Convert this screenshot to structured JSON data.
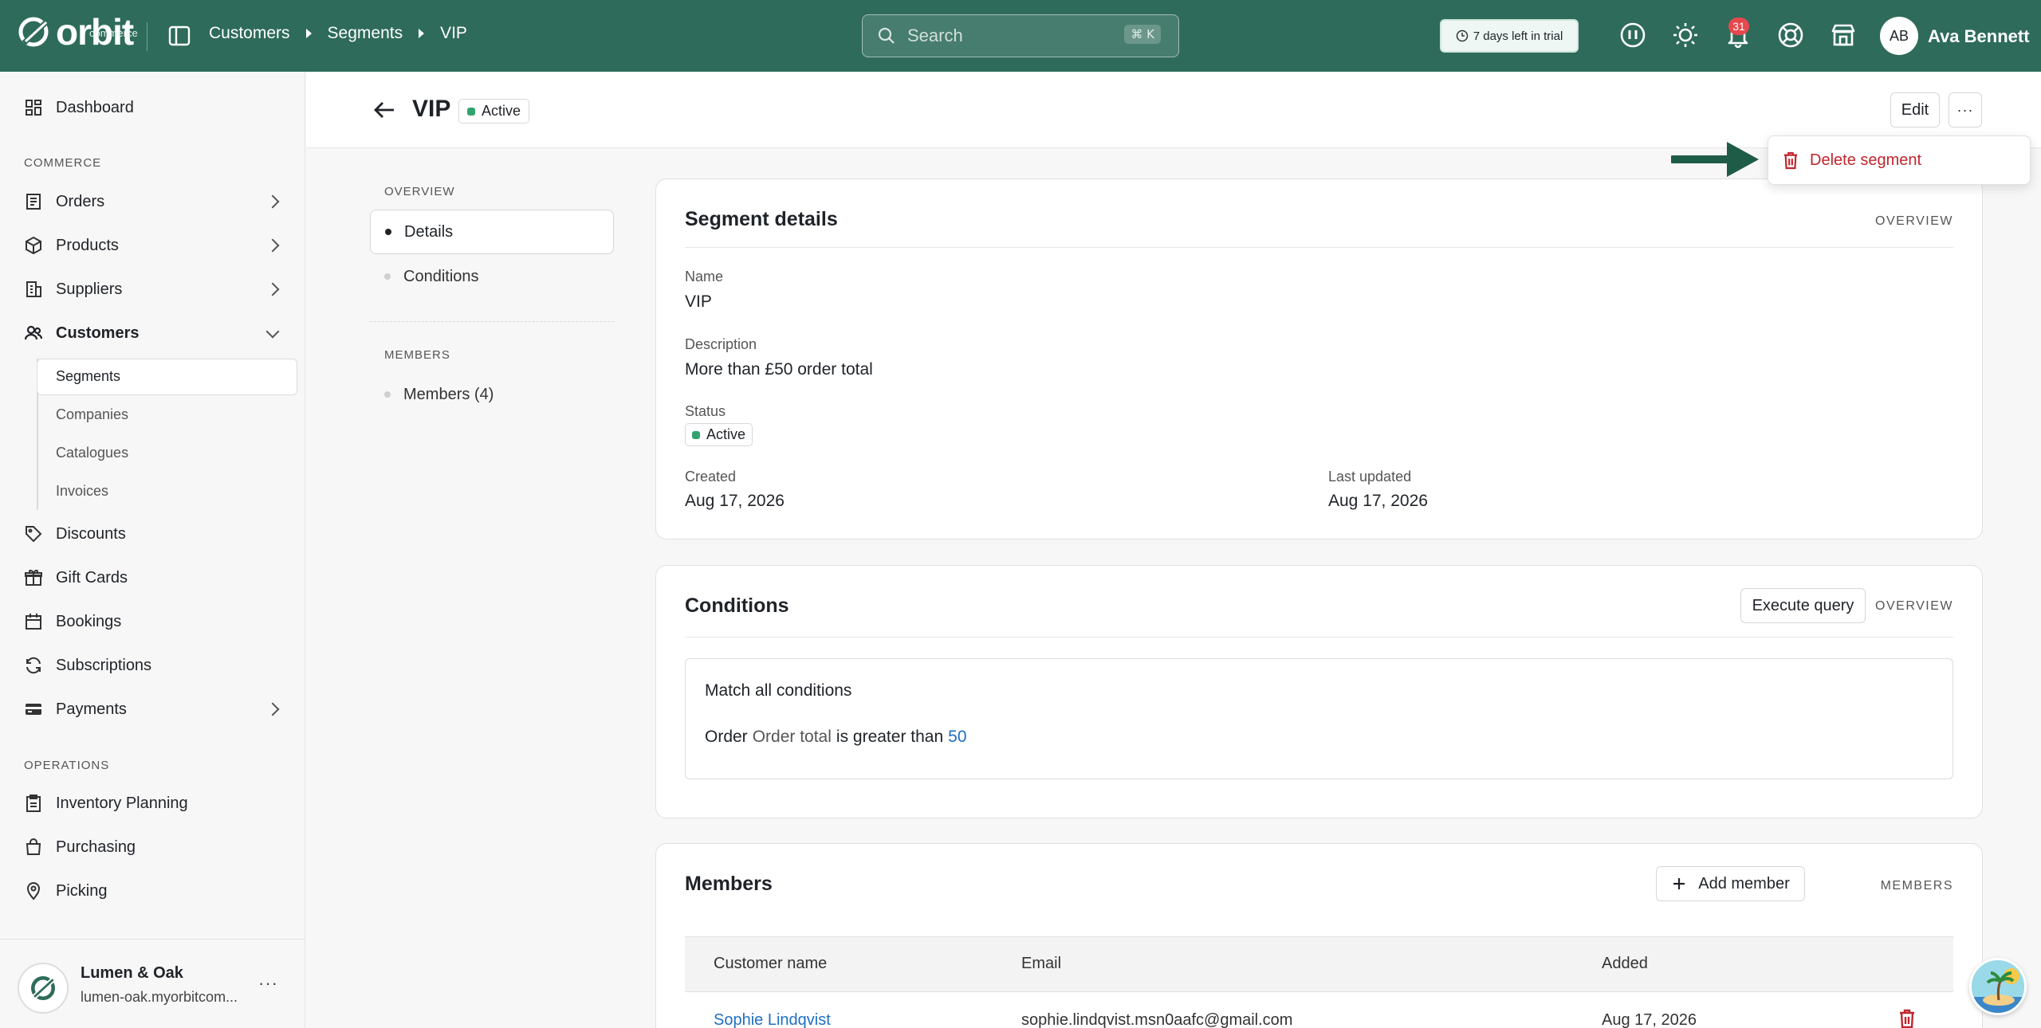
{
  "topbar": {
    "logo_text": "orbit",
    "logo_sub": "commerce",
    "breadcrumbs": [
      "Customers",
      "Segments",
      "VIP"
    ],
    "search_placeholder": "Search",
    "search_shortcut": "⌘ K",
    "trial_text": "7 days left in trial",
    "notification_count": "31",
    "user_initials": "AB",
    "user_name": "Ava Bennett"
  },
  "sidebar": {
    "dashboard": "Dashboard",
    "commerce_label": "COMMERCE",
    "orders": "Orders",
    "products": "Products",
    "suppliers": "Suppliers",
    "customers": "Customers",
    "customer_subitems": [
      "Segments",
      "Companies",
      "Catalogues",
      "Invoices"
    ],
    "discounts": "Discounts",
    "gift_cards": "Gift Cards",
    "bookings": "Bookings",
    "subscriptions": "Subscriptions",
    "payments": "Payments",
    "operations_label": "OPERATIONS",
    "inventory_planning": "Inventory Planning",
    "purchasing": "Purchasing",
    "picking": "Picking",
    "org_name": "Lumen & Oak",
    "org_domain": "lumen-oak.myorbitcom..."
  },
  "page": {
    "title": "VIP",
    "status": "Active",
    "edit_label": "Edit",
    "more_label": "···",
    "delete_label": "Delete segment"
  },
  "inner_nav": {
    "overview_label": "OVERVIEW",
    "details": "Details",
    "conditions": "Conditions",
    "members_label": "MEMBERS",
    "members": "Members (4)"
  },
  "details_card": {
    "title": "Segment details",
    "tag": "OVERVIEW",
    "name_label": "Name",
    "name_value": "VIP",
    "description_label": "Description",
    "description_value": "More than £50 order total",
    "status_label": "Status",
    "status_value": "Active",
    "created_label": "Created",
    "created_value": "Aug 17, 2026",
    "updated_label": "Last updated",
    "updated_value": "Aug 17, 2026"
  },
  "conditions_card": {
    "title": "Conditions",
    "execute_label": "Execute query",
    "tag": "OVERVIEW",
    "match_text": "Match all conditions",
    "cond_entity": "Order",
    "cond_field": "Order total",
    "cond_operator": "is greater than",
    "cond_value": "50"
  },
  "members_card": {
    "title": "Members",
    "add_label": "Add member",
    "tag": "MEMBERS",
    "columns": [
      "Customer name",
      "Email",
      "Added"
    ],
    "rows": [
      {
        "name": "Sophie Lindqvist",
        "email": "sophie.lindqvist.msn0aafc@gmail.com",
        "added": "Aug 17, 2026"
      }
    ]
  },
  "colors": {
    "topbar": "#2e6b5a",
    "accent_green": "#30a46c",
    "danger": "#c0262d",
    "link": "#1f6fc5"
  }
}
